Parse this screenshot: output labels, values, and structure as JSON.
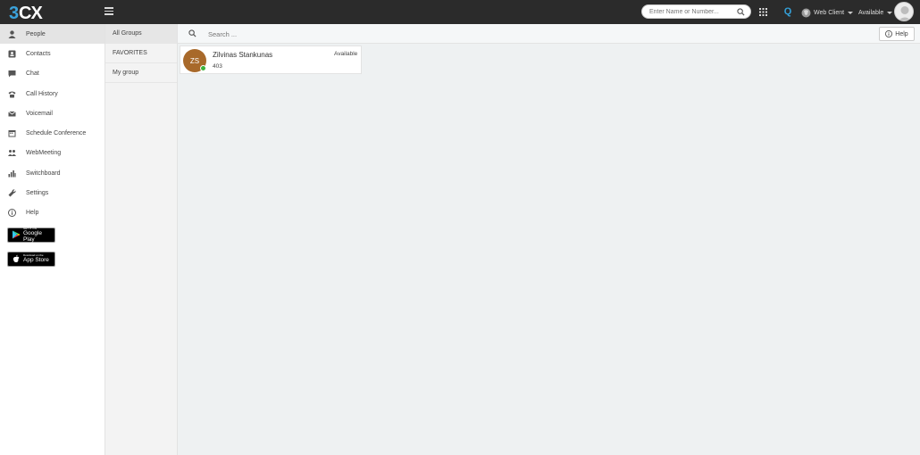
{
  "app": {
    "logo_text": "3CX"
  },
  "topbar": {
    "search_placeholder": "Enter Name or Number...",
    "webclient_label": "Web Client",
    "status_label": "Available",
    "q_label": "Q"
  },
  "nav": {
    "items": [
      {
        "label": "People",
        "icon": "person-icon"
      },
      {
        "label": "Contacts",
        "icon": "contacts-icon"
      },
      {
        "label": "Chat",
        "icon": "chat-icon"
      },
      {
        "label": "Call History",
        "icon": "phone-icon"
      },
      {
        "label": "Voicemail",
        "icon": "envelope-icon"
      },
      {
        "label": "Schedule Conference",
        "icon": "calendar-icon"
      },
      {
        "label": "WebMeeting",
        "icon": "webmeeting-icon"
      },
      {
        "label": "Switchboard",
        "icon": "bar-chart-icon"
      },
      {
        "label": "Settings",
        "icon": "wrench-icon"
      },
      {
        "label": "Help",
        "icon": "info-icon"
      }
    ],
    "google_play": {
      "small": "GET IT ON",
      "big": "Google Play"
    },
    "app_store": {
      "small": "Download on the",
      "big": "App Store"
    }
  },
  "groups": {
    "items": [
      "All Groups",
      "FAVORITES",
      "My group"
    ]
  },
  "main": {
    "search_placeholder": "Search ...",
    "help_label": "Help"
  },
  "contacts": [
    {
      "initials": "ZS",
      "name": "Zilvinas Stankunas",
      "extension": "403",
      "status": "Available",
      "avatar_color": "#a8692a",
      "presence_color": "#3cb33c"
    }
  ],
  "colors": {
    "topbar": "#2b2b2b",
    "accent": "#34a0d8",
    "active_nav": "#e4e4e4"
  }
}
